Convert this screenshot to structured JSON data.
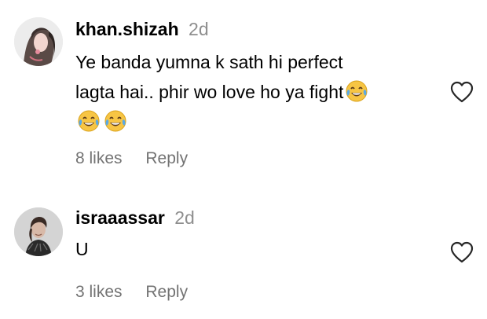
{
  "comments": [
    {
      "username": "khan.shizah",
      "timestamp": "2d",
      "text_line1": "Ye banda yumna k sath hi perfect",
      "text_line2": "lagta hai.. phir wo love ho ya fight",
      "emoji": "face-with-tears-of-joy",
      "likes_label": "8 likes",
      "reply_label": "Reply"
    },
    {
      "username": "israaassar",
      "timestamp": "2d",
      "text": "U",
      "likes_label": "3 likes",
      "reply_label": "Reply"
    }
  ],
  "colors": {
    "text": "#000000",
    "secondary": "#737373",
    "timestamp": "#8e8e8e",
    "emoji_face": "#f7c544",
    "emoji_tears": "#5aa9e6"
  },
  "icons": {
    "like": "heart-outline-icon"
  }
}
